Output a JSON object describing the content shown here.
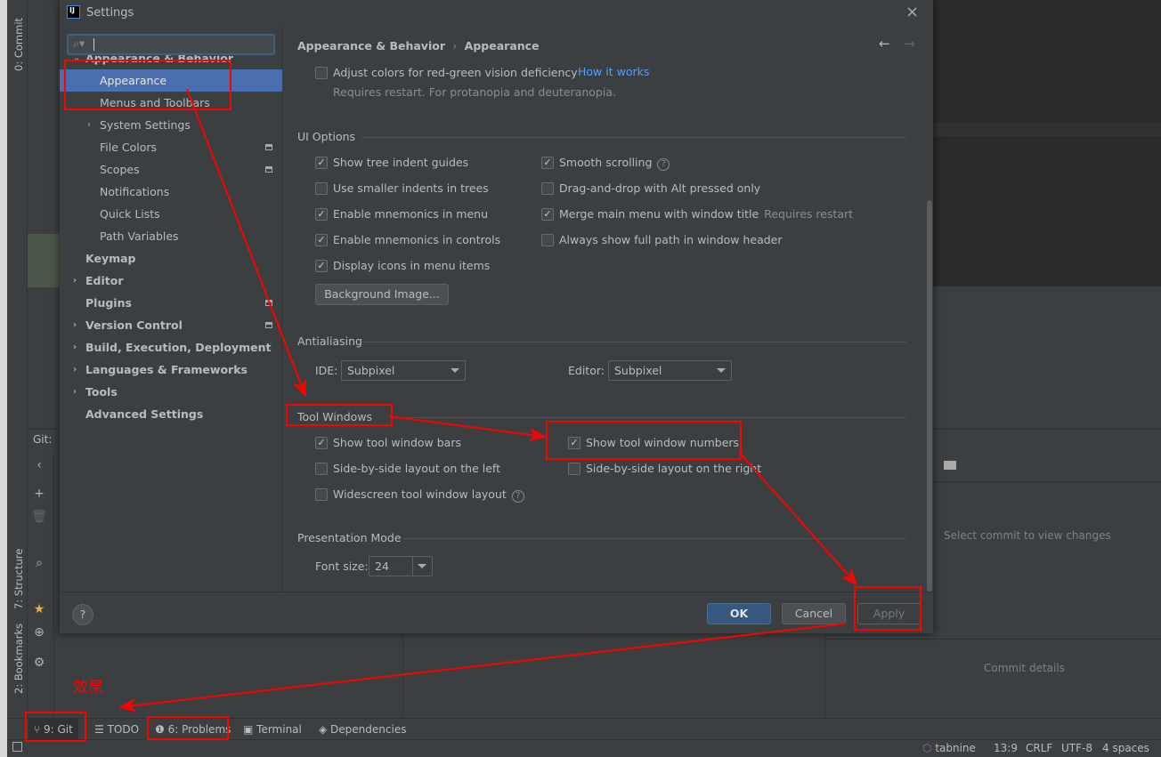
{
  "ide": {
    "left_stripe": [
      "0: Commit",
      "7: Structure",
      "2: Bookmarks"
    ],
    "git_label": "Git:",
    "select_commit": "Select commit to view changes",
    "commit_details": "Commit details",
    "toolwindows": [
      {
        "label": "9: Git",
        "icon": "git-branch-icon"
      },
      {
        "label": "TODO",
        "icon": "list-icon"
      },
      {
        "label": "6: Problems",
        "icon": "problems-icon"
      },
      {
        "label": "Terminal",
        "icon": "terminal-icon"
      },
      {
        "label": "Dependencies",
        "icon": "layers-icon"
      }
    ],
    "status": {
      "plugin": "tabnine",
      "position": "13:9",
      "line_sep": "CRLF",
      "encoding": "UTF-8",
      "indent": "4 spaces"
    }
  },
  "dialog": {
    "title": "Settings",
    "search": {
      "value": "",
      "placeholder": ""
    },
    "tree": [
      {
        "label": "Appearance & Behavior",
        "level": 0,
        "bold": true,
        "expanded": true
      },
      {
        "label": "Appearance",
        "level": 1,
        "selected": true
      },
      {
        "label": "Menus and Toolbars",
        "level": 1
      },
      {
        "label": "System Settings",
        "level": 1,
        "chevron": true
      },
      {
        "label": "File Colors",
        "level": 1,
        "project_icon": true
      },
      {
        "label": "Scopes",
        "level": 1,
        "project_icon": true
      },
      {
        "label": "Notifications",
        "level": 1
      },
      {
        "label": "Quick Lists",
        "level": 1
      },
      {
        "label": "Path Variables",
        "level": 1
      },
      {
        "label": "Keymap",
        "level": 0,
        "bold": true
      },
      {
        "label": "Editor",
        "level": 0,
        "bold": true,
        "chevron": true
      },
      {
        "label": "Plugins",
        "level": 0,
        "bold": true,
        "project_icon": true
      },
      {
        "label": "Version Control",
        "level": 0,
        "bold": true,
        "chevron": true,
        "project_icon": true
      },
      {
        "label": "Build, Execution, Deployment",
        "level": 0,
        "bold": true,
        "chevron": true
      },
      {
        "label": "Languages & Frameworks",
        "level": 0,
        "bold": true,
        "chevron": true
      },
      {
        "label": "Tools",
        "level": 0,
        "bold": true,
        "chevron": true
      },
      {
        "label": "Advanced Settings",
        "level": 0,
        "bold": true
      }
    ],
    "breadcrumb": {
      "parent": "Appearance & Behavior",
      "current": "Appearance"
    },
    "colorblind": {
      "label": "Adjust colors for red-green vision deficiency",
      "checked": false,
      "link": "How it works",
      "hint": "Requires restart. For protanopia and deuteranopia."
    },
    "ui_options": {
      "title": "UI Options",
      "left": [
        {
          "label": "Show tree indent guides",
          "checked": true
        },
        {
          "label": "Use smaller indents in trees",
          "checked": false
        },
        {
          "label": "Enable mnemonics in menu",
          "checked": true
        },
        {
          "label": "Enable mnemonics in controls",
          "checked": true
        },
        {
          "label": "Display icons in menu items",
          "checked": true
        }
      ],
      "right": [
        {
          "label": "Smooth scrolling",
          "checked": true,
          "help": true
        },
        {
          "label": "Drag-and-drop with Alt pressed only",
          "checked": false
        },
        {
          "label": "Merge main menu with window title",
          "checked": true,
          "hint": "Requires restart"
        },
        {
          "label": "Always show full path in window header",
          "checked": false
        }
      ],
      "background_button": "Background Image..."
    },
    "antialiasing": {
      "title": "Antialiasing",
      "ide_label": "IDE:",
      "ide_value": "Subpixel",
      "editor_label": "Editor:",
      "editor_value": "Subpixel"
    },
    "tool_windows": {
      "title": "Tool Windows",
      "items": [
        {
          "label": "Show tool window bars",
          "checked": true
        },
        {
          "label": "Show tool window numbers",
          "checked": true
        },
        {
          "label": "Side-by-side layout on the left",
          "checked": false
        },
        {
          "label": "Side-by-side layout on the right",
          "checked": false
        },
        {
          "label": "Widescreen tool window layout",
          "checked": false,
          "help": true
        }
      ]
    },
    "presentation": {
      "title": "Presentation Mode",
      "font_label": "Font size:",
      "font_value": "24"
    },
    "buttons": {
      "ok": "OK",
      "cancel": "Cancel",
      "apply": "Apply",
      "help": "?"
    }
  },
  "annotation": {
    "text": "效果",
    "color": "#ff0000"
  },
  "colors": {
    "accent": "#4b6eaf",
    "link": "#589df6",
    "ok_button": "#365880",
    "annotation": "#ff0000"
  }
}
